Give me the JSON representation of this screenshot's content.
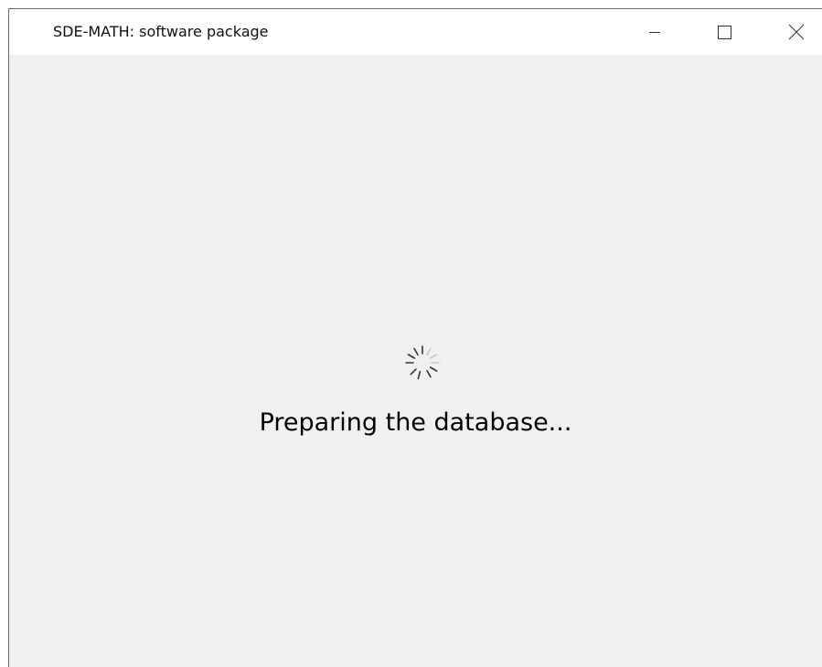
{
  "window": {
    "title": "SDE-MATH: software package",
    "controls": {
      "minimize_icon": "minimize-icon",
      "maximize_icon": "maximize-icon",
      "close_icon": "close-icon"
    }
  },
  "main": {
    "status_text": "Preparing the database...",
    "spinner_icon": "loading-spinner-icon"
  },
  "colors": {
    "titlebar_bg": "#ffffff",
    "content_bg": "#f0f0f0",
    "text": "#000000",
    "spinner_dark": "#333333",
    "spinner_light": "#c8c8c8"
  }
}
